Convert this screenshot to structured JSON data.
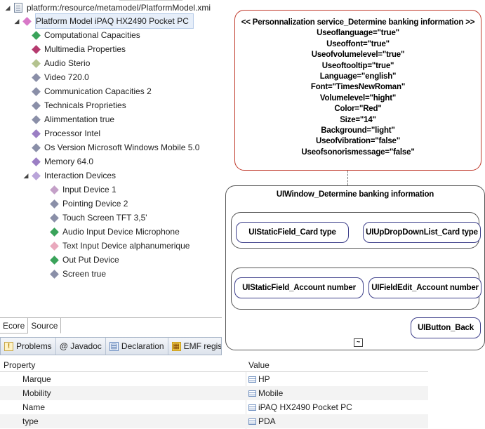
{
  "tree": {
    "root": "platform:/resource/metamodel/PlatformModel.xmi",
    "model": "Platform Model iPAQ HX2490 Pocket PC",
    "items": [
      {
        "label": "Computational Capacities",
        "color": "#3aa35a"
      },
      {
        "label": "Multimedia Properties",
        "color": "#b53a6e"
      },
      {
        "label": "Audio Sterio",
        "color": "#b4c38f"
      },
      {
        "label": "Video 720.0",
        "color": "#8a8fa8"
      },
      {
        "label": "Communication Capacities 2",
        "color": "#8a8fa8"
      },
      {
        "label": "Technicals Proprieties",
        "color": "#8a8fa8"
      },
      {
        "label": "Alimmentation true",
        "color": "#8a8fa8"
      },
      {
        "label": "Processor Intel",
        "color": "#9b7ec4"
      },
      {
        "label": "Os Version Microsoft Windows Mobile 5.0",
        "color": "#8a8fa8"
      },
      {
        "label": "Memory 64.0",
        "color": "#9b7ec4"
      },
      {
        "label": "Interaction Devices",
        "color": "#b9a4d9"
      }
    ],
    "interaction_children": [
      {
        "label": "Input Device 1",
        "color": "#c4a0c8"
      },
      {
        "label": "Pointing Device 2",
        "color": "#8a8fa8"
      },
      {
        "label": "Touch Screen TFT 3,5'",
        "color": "#8a8fa8"
      },
      {
        "label": "Audio Input Device Microphone",
        "color": "#3aa35a"
      },
      {
        "label": "Text Input Device alphanumerique",
        "color": "#e9a9bd"
      },
      {
        "label": "Out Put Device",
        "color": "#3aa35a"
      },
      {
        "label": "Screen true",
        "color": "#8a8fa8"
      }
    ]
  },
  "editor_tabs": [
    "Ecore",
    "Source"
  ],
  "view_tabs": [
    {
      "label": "Problems",
      "icon": "problems-icon"
    },
    {
      "label": "@ Javadoc",
      "icon": "javadoc-icon"
    },
    {
      "label": "Declaration",
      "icon": "declaration-icon"
    },
    {
      "label": "EMF registered",
      "icon": "emf-registered-icon"
    }
  ],
  "properties": {
    "header": {
      "property": "Property",
      "value": "Value"
    },
    "rows": [
      {
        "name": "Marque",
        "value": "HP"
      },
      {
        "name": "Mobility",
        "value": "Mobile"
      },
      {
        "name": "Name",
        "value": "iPAQ HX2490 Pocket PC"
      },
      {
        "name": "type",
        "value": "PDA"
      }
    ]
  },
  "diagram": {
    "personalization_lines": [
      "<< Personnalization service_Determine banking information >>",
      "Useoflanguage=\"true\"",
      "Useoffont=\"true\"",
      "Useofvolumelevel=\"true\"",
      "Useoftooltip=\"true\"",
      "Language=\"english\"",
      "Font=\"TimesNewRoman\"",
      "Volumelevel=\"hight\"",
      "Color=\"Red\"",
      "Size=\"14\"",
      "Background=\"light\"",
      "Useofvibration=\"false\"",
      "Useofsonorismessage=\"false\""
    ],
    "window_title": "UIWindow_Determine banking information",
    "static_field_card": "UIStaticField_Card type",
    "dropdown_card": "UIUpDropDownList_Card type",
    "static_field_account": "UIStaticField_Account number",
    "field_edit_account": "UIFieldEdit_Account number",
    "button_back": "UIButton_Back",
    "collapse_symbol": "~"
  }
}
